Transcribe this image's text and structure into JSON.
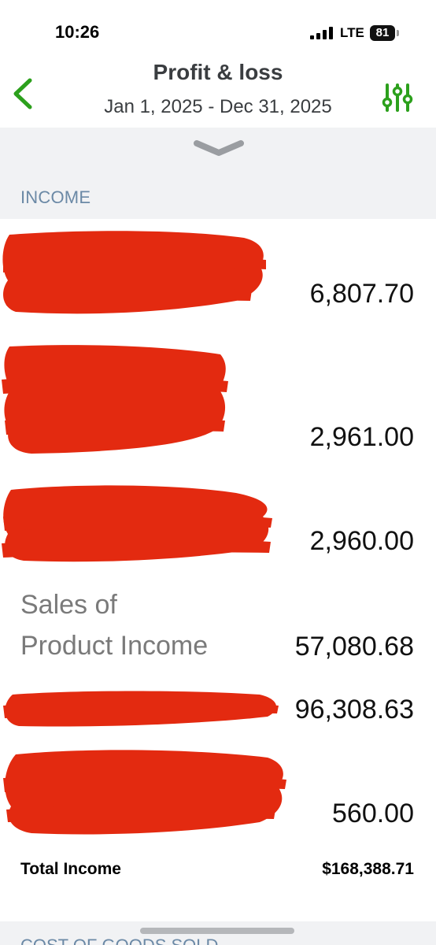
{
  "status_bar": {
    "time": "10:26",
    "network": "LTE",
    "battery": "81",
    "icons": [
      "signal-icon",
      "battery-icon"
    ]
  },
  "header": {
    "title": "Profit & loss",
    "subtitle": "Jan 1, 2025 - Dec 31, 2025",
    "back_icon": "chevron-left-icon",
    "filter_icon": "sliders-icon",
    "accent_color": "#2ca01c"
  },
  "collapse_icon": "chevron-down-icon",
  "income": {
    "section_label": "INCOME",
    "rows": [
      {
        "label": "",
        "redacted": true,
        "amount": "6,807.70"
      },
      {
        "label": "",
        "redacted": true,
        "amount": "2,961.00"
      },
      {
        "label": "",
        "redacted": true,
        "amount": "2,960.00"
      },
      {
        "label_line1": "Sales of",
        "label_line2": "Product Income",
        "redacted": false,
        "amount": "57,080.68"
      },
      {
        "label": "",
        "redacted": true,
        "amount": "96,308.63"
      },
      {
        "label": "",
        "redacted": true,
        "amount": "560.00"
      }
    ],
    "total_label": "Total Income",
    "total_value": "$168,388.71"
  },
  "next_section": {
    "label": "COST OF GOODS SOLD"
  },
  "colors": {
    "redaction": "#e32a10",
    "section_label": "#6b89a6",
    "section_bg": "#f1f2f4"
  }
}
